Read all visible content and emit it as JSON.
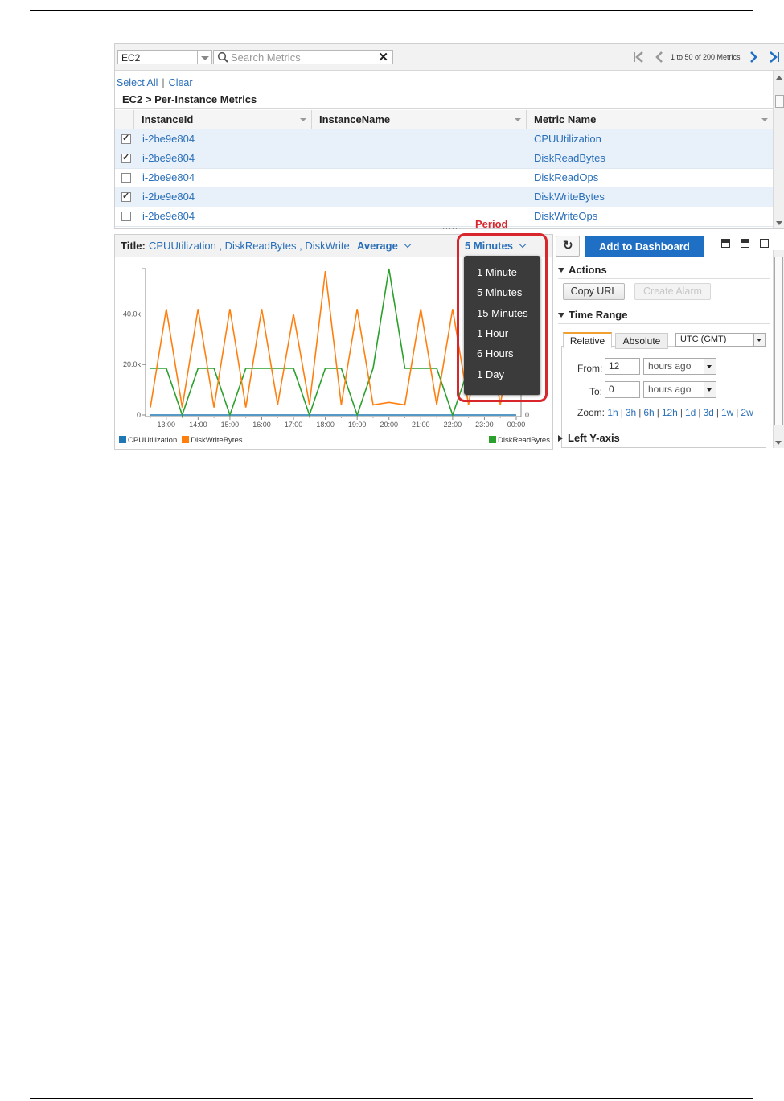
{
  "search_bar": {
    "namespace": "EC2",
    "placeholder": "Search Metrics",
    "pager_text": "1 to 50 of 200 Metrics"
  },
  "selection_links": {
    "select_all": "Select All",
    "clear": "Clear"
  },
  "breadcrumb": "EC2 > Per-Instance Metrics",
  "table": {
    "columns": [
      "InstanceId",
      "InstanceName",
      "Metric Name"
    ],
    "rows": [
      {
        "checked": true,
        "instance_id": "i-2be9e804",
        "instance_name": "",
        "metric": "CPUUtilization"
      },
      {
        "checked": true,
        "instance_id": "i-2be9e804",
        "instance_name": "",
        "metric": "DiskReadBytes"
      },
      {
        "checked": false,
        "instance_id": "i-2be9e804",
        "instance_name": "",
        "metric": "DiskReadOps"
      },
      {
        "checked": true,
        "instance_id": "i-2be9e804",
        "instance_name": "",
        "metric": "DiskWriteBytes"
      },
      {
        "checked": false,
        "instance_id": "i-2be9e804",
        "instance_name": "",
        "metric": "DiskWriteOps"
      }
    ]
  },
  "graph": {
    "title_label": "Title:",
    "title_value": "CPUUtilization , DiskReadBytes , DiskWrite",
    "statistic": "Average",
    "period": "5 Minutes",
    "period_annotation": "Period",
    "period_options": [
      "1 Minute",
      "5 Minutes",
      "15 Minutes",
      "1 Hour",
      "6 Hours",
      "1 Day"
    ]
  },
  "chart_data": {
    "type": "line",
    "x": [
      "12:30",
      "13:00",
      "13:30",
      "14:00",
      "14:30",
      "15:00",
      "15:30",
      "16:00",
      "16:30",
      "17:00",
      "17:30",
      "18:00",
      "18:30",
      "19:00",
      "19:30",
      "20:00",
      "20:30",
      "21:00",
      "21:30",
      "22:00",
      "22:30",
      "23:00",
      "23:30",
      "00:00"
    ],
    "x_tick_labels": [
      "13:00",
      "14:00",
      "15:00",
      "16:00",
      "17:00",
      "18:00",
      "19:00",
      "20:00",
      "21:00",
      "22:00",
      "23:00",
      "00:00"
    ],
    "y_tick_labels": [
      "0",
      "20.0k",
      "40.0k"
    ],
    "right_y_tick_labels": [
      "0"
    ],
    "ylim": [
      0,
      58000
    ],
    "series": [
      {
        "name": "CPUUtilization",
        "color": "#1f77b4",
        "values": [
          0,
          0,
          0,
          0,
          0,
          0,
          0,
          0,
          0,
          0,
          0,
          0,
          0,
          0,
          0,
          0,
          0,
          0,
          0,
          0,
          0,
          0,
          0,
          0
        ]
      },
      {
        "name": "DiskWriteBytes",
        "color": "#ff7f0e",
        "values": [
          3000,
          42000,
          3000,
          42000,
          3000,
          42000,
          3000,
          42000,
          4000,
          40000,
          4000,
          57000,
          4000,
          42000,
          4000,
          5000,
          4000,
          42000,
          4000,
          42000,
          4000,
          42000,
          4000,
          42000
        ]
      },
      {
        "name": "DiskReadBytes",
        "color": "#2ca02c",
        "values": [
          18500,
          18500,
          0,
          18500,
          18500,
          0,
          18500,
          18500,
          18500,
          18500,
          0,
          18500,
          18500,
          0,
          18500,
          58000,
          18500,
          18500,
          18500,
          0,
          18500,
          18500,
          18500,
          18500
        ]
      }
    ],
    "grid": false,
    "legend": "bottom"
  },
  "options": {
    "add_to_dashboard": "Add to Dashboard",
    "actions_title": "Actions",
    "copy_url": "Copy URL",
    "create_alarm": "Create Alarm",
    "time_range_title": "Time Range",
    "tab_relative": "Relative",
    "tab_absolute": "Absolute",
    "timezone": "UTC (GMT)",
    "from_label": "From:",
    "from_value": "12",
    "from_unit": "hours ago",
    "to_label": "To:",
    "to_value": "0",
    "to_unit": "hours ago",
    "zoom_label": "Zoom:",
    "zoom_options": [
      "1h",
      "3h",
      "6h",
      "12h",
      "1d",
      "3d",
      "1w",
      "2w"
    ],
    "left_y_axis_title": "Left Y-axis"
  },
  "colors": {
    "link": "#2a6fb8",
    "primary_button": "#1f6fc4",
    "annotation_red": "#d9262c"
  }
}
